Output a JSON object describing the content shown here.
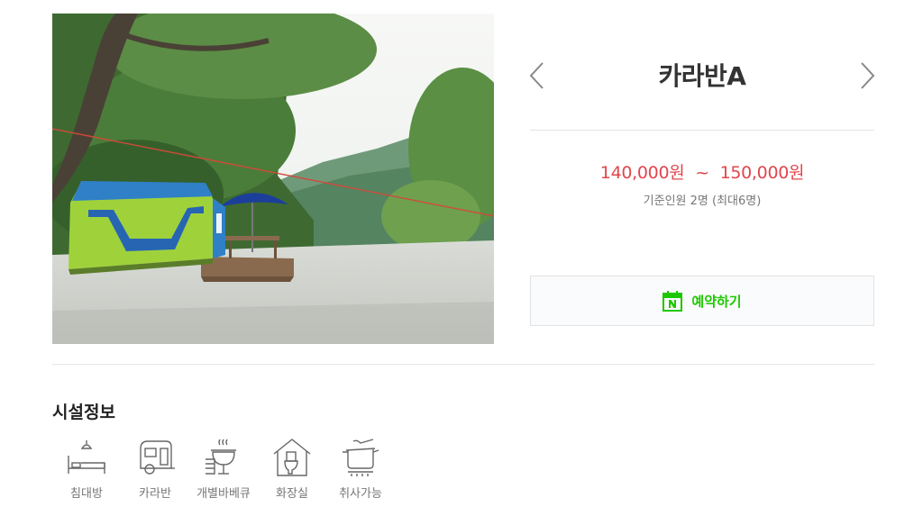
{
  "room": {
    "name": "카라반A",
    "photo_alt": "카라반A 사진",
    "price_min": "140,000원",
    "price_separator": "~",
    "price_max": "150,000원",
    "capacity": "기준인원 2명 (최대6명)"
  },
  "navigation": {
    "prev_icon": "chevron-left-icon",
    "next_icon": "chevron-right-icon"
  },
  "reserve": {
    "label": "예약하기",
    "icon": "naver-calendar-icon",
    "color": "#1ec800"
  },
  "facilities_section": {
    "title": "시설정보",
    "items": [
      {
        "label": "침대방",
        "icon": "bed-icon"
      },
      {
        "label": "카라반",
        "icon": "caravan-icon"
      },
      {
        "label": "개별바베큐",
        "icon": "barbecue-grill-icon"
      },
      {
        "label": "화장실",
        "icon": "toilet-icon"
      },
      {
        "label": "취사가능",
        "icon": "cooking-pot-icon"
      }
    ]
  },
  "colors": {
    "price": "#e0464e",
    "text": "#333333",
    "muted": "#777777",
    "border": "#e4e4e4"
  }
}
